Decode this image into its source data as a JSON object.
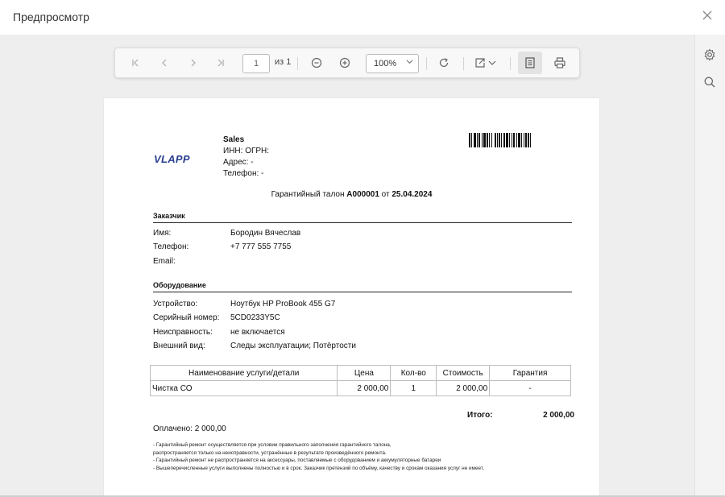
{
  "dialog": {
    "title": "Предпросмотр",
    "close_icon": "close-icon"
  },
  "toolbar": {
    "first_icon": "first-page-icon",
    "prev_icon": "prev-page-icon",
    "next_icon": "next-page-icon",
    "last_icon": "last-page-icon",
    "page_value": "1",
    "page_of": "из 1",
    "zoom_out_icon": "zoom-out-icon",
    "zoom_in_icon": "zoom-in-icon",
    "zoom_value": "100%",
    "refresh_icon": "refresh-icon",
    "export_icon": "export-icon",
    "page_view_icon": "page-view-icon",
    "print_icon": "print-icon"
  },
  "sidebar": {
    "settings_icon": "gear-icon",
    "search_icon": "search-icon"
  },
  "document": {
    "logo": "VLAPP",
    "company": {
      "name": "Sales",
      "inn_ogrn": "ИНН:  ОГРН:",
      "address": "Адрес: -",
      "phone": "Телефон: -"
    },
    "title_prefix": "Гарантийный талон ",
    "title_number": "А000001",
    "title_mid": " от ",
    "title_date": "25.04.2024",
    "customer_header": "Заказчик",
    "customer": [
      {
        "label": "Имя:",
        "value": "Бородин Вячеслав"
      },
      {
        "label": "Телефон:",
        "value": "+7 777 555 7755"
      },
      {
        "label": "Email:",
        "value": ""
      }
    ],
    "equipment_header": "Оборудование",
    "equipment": [
      {
        "label": "Устройство:",
        "value": "Ноутбук HP ProBook 455 G7"
      },
      {
        "label": "Серийный номер:",
        "value": "5CD0233Y5C"
      },
      {
        "label": "Неисправность:",
        "value": "не включается"
      },
      {
        "label": "Внешний вид:",
        "value": "Следы эксплуатации; Потёртости"
      }
    ],
    "table_headers": [
      "Наименование услуги/детали",
      "Цена",
      "Кол-во",
      "Стоимость",
      "Гарантия"
    ],
    "table_rows": [
      [
        "Чистка СО",
        "2 000,00",
        "1",
        "2 000,00",
        "-"
      ]
    ],
    "total_label": "Итого:",
    "total_value": "2 000,00",
    "paid": "Оплачено:  2 000,00",
    "notes": [
      "- Гарантийный ремонт осуществляется при условии правильного заполнения гарантийного талона,",
      "распространяется только на неисправности, устранённые в результате произведённого ремонта.",
      "- Гарантийный ремонт не распространяется на аксессуары, поставляемые с оборудованием и аккумуляторные батареи",
      "- Вышеперечисленные услуги выполнены полностью и в срок. Заказчик претензий по объёму, качеству и срокам оказания услуг не имеет."
    ]
  }
}
